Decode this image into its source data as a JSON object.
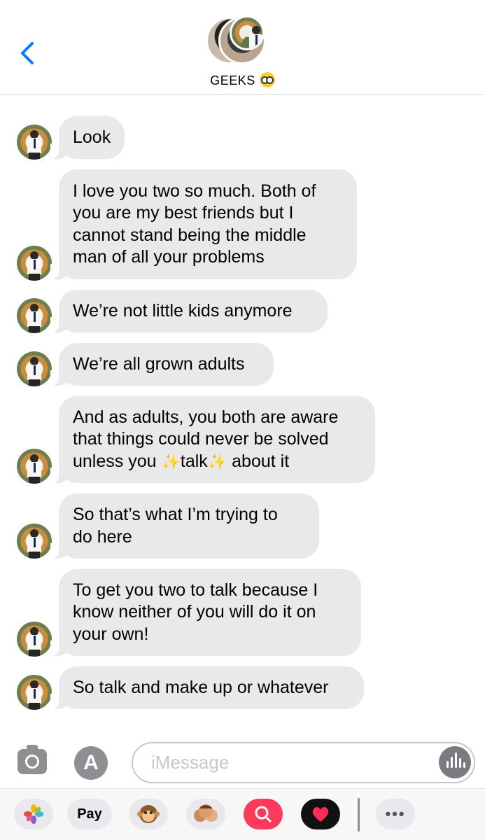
{
  "header": {
    "group_name": "GEEKS",
    "group_emoji": "nerd-face-icon"
  },
  "messages": [
    {
      "text": "Look"
    },
    {
      "text": "I love you two so much. Both of\nyou are my best friends but I\ncannot stand being the middle\nman of all your problems"
    },
    {
      "text": "We’re not little kids anymore"
    },
    {
      "text": "We’re all grown adults"
    },
    {
      "text_line1": "And as adults, you both are aware",
      "text_line2": "that things could never be solved",
      "text_line3_a": "unless you ",
      "sparkle": "✨",
      "text_line3_b": "talk",
      "text_line3_c": " about it"
    },
    {
      "text": "So that’s what I’m trying to\ndo here"
    },
    {
      "text": "To get you two to talk because I\nknow neither of you will do it on\nyour own!"
    },
    {
      "text": "So talk and make up or whatever"
    }
  ],
  "compose": {
    "placeholder": "iMessage"
  },
  "drawer": {
    "pay_label": "Pay",
    "apple_glyph": "",
    "more_label": "•••"
  },
  "colors": {
    "bubble_bg": "#e9e9eb",
    "back_blue": "#0a7aff",
    "placeholder": "#c7c7cc"
  }
}
